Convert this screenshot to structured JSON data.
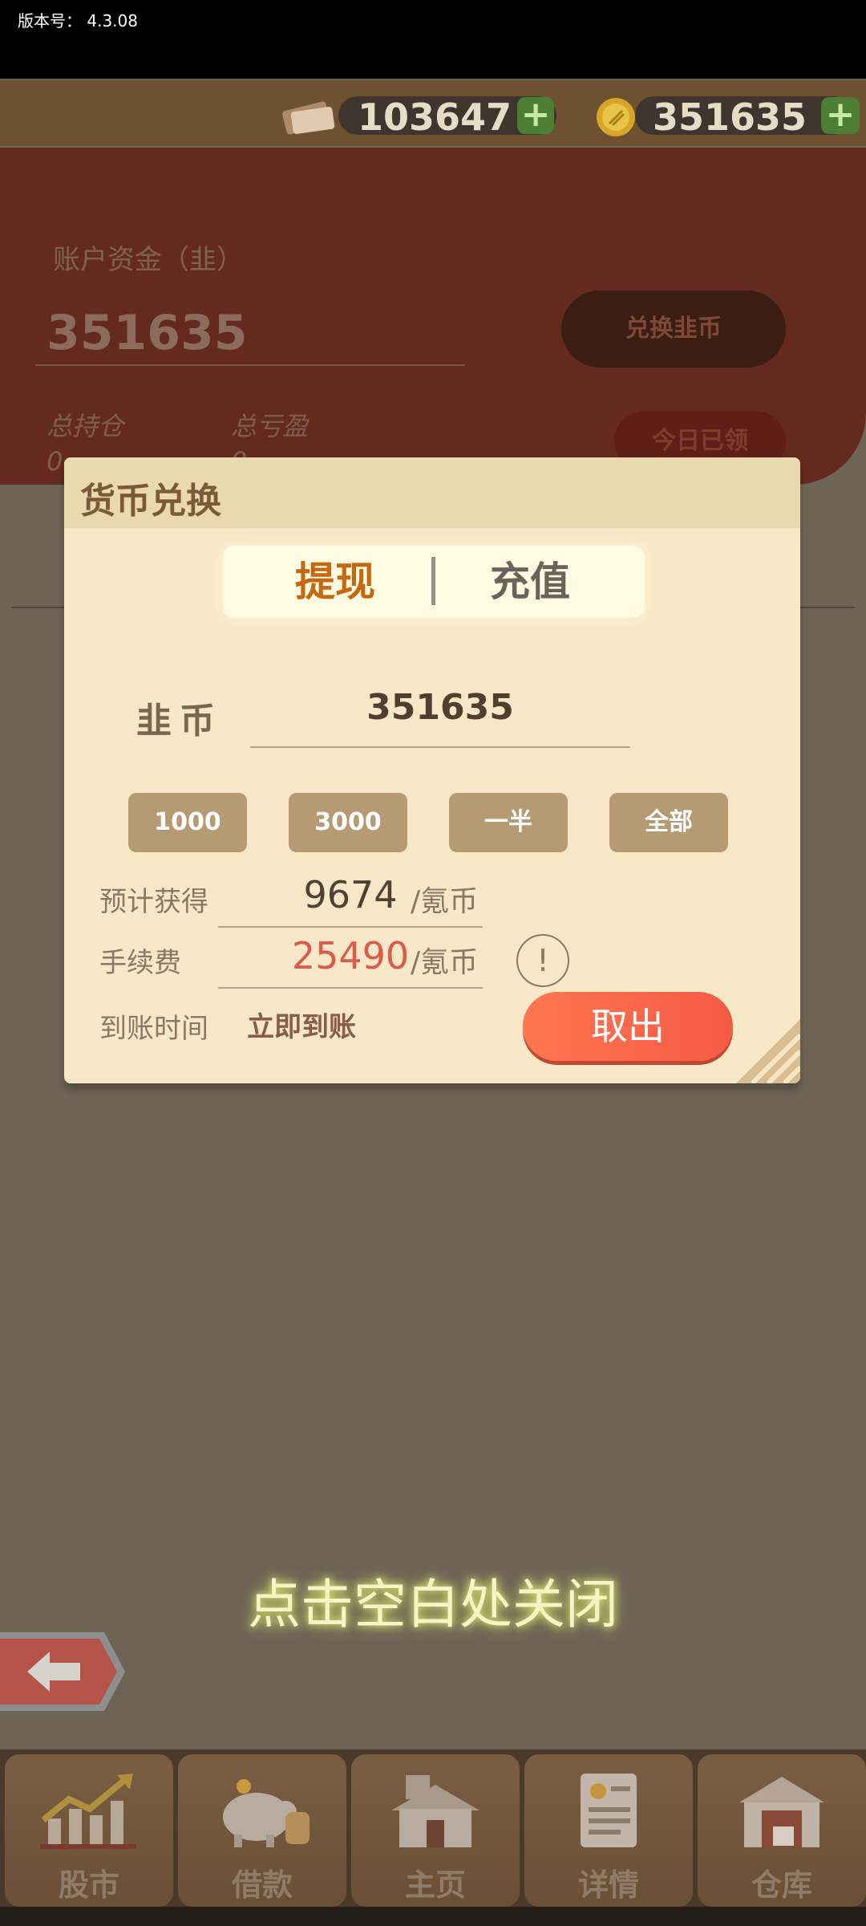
{
  "status_bar": {
    "version_label": "版本号： 4.3.08"
  },
  "top_bar": {
    "ticket_amount": "103647",
    "coin_amount": "351635",
    "plus_symbol": "+"
  },
  "account_panel": {
    "funds_label": "账户资金（韭）",
    "funds_value": "351635",
    "exchange_button": "兑换韭币",
    "total_holdings_label": "总持仓",
    "total_holdings_value": "0",
    "total_pl_label": "总亏盈",
    "total_pl_value": "0",
    "today_claimed_button": "今日已领"
  },
  "dialog": {
    "title": "货币兑换",
    "tabs": [
      {
        "label": "提现",
        "active": true
      },
      {
        "label": "充值",
        "active": false
      }
    ],
    "currency_label": "韭币",
    "amount_value": "351635",
    "quick_amounts": [
      "1000",
      "3000",
      "一半",
      "全部"
    ],
    "expected_label": "预计获得",
    "expected_value": "9674",
    "expected_unit": "/氪币",
    "fee_label": "手续费",
    "fee_value": "25490",
    "fee_unit": "/氪币",
    "info_symbol": "!",
    "arrival_label": "到账时间",
    "arrival_value": "立即到账",
    "withdraw_button": "取出"
  },
  "close_hint": "点击空白处关闭",
  "bottom_nav": {
    "items": [
      {
        "label": "股市",
        "icon": "stock-chart-icon"
      },
      {
        "label": "借款",
        "icon": "piggy-bank-icon"
      },
      {
        "label": "主页",
        "icon": "house-icon"
      },
      {
        "label": "详情",
        "icon": "document-icon"
      },
      {
        "label": "仓库",
        "icon": "warehouse-icon"
      }
    ]
  },
  "colors": {
    "accent_orange": "#c46812",
    "withdraw_button": "#f55a45",
    "fee_red": "#dd5a4a",
    "dialog_bg": "#f9e8c7"
  }
}
